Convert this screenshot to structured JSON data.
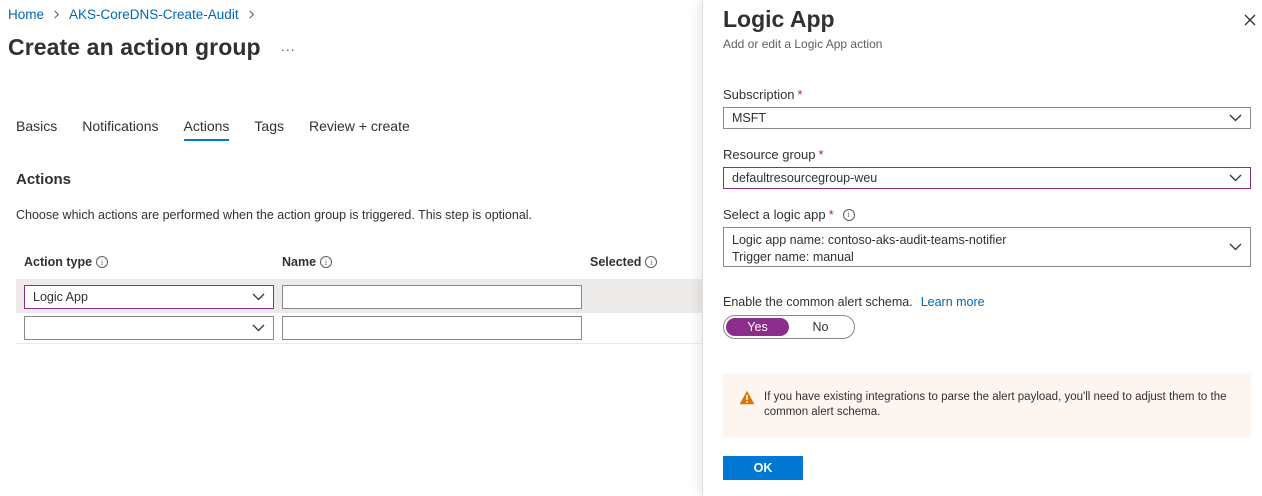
{
  "breadcrumb": {
    "items": [
      "Home",
      "AKS-CoreDNS-Create-Audit"
    ]
  },
  "page": {
    "title": "Create an action group",
    "more": "..."
  },
  "tabs": [
    {
      "label": "Basics",
      "active": false
    },
    {
      "label": "Notifications",
      "active": false
    },
    {
      "label": "Actions",
      "active": true
    },
    {
      "label": "Tags",
      "active": false
    },
    {
      "label": "Review + create",
      "active": false
    }
  ],
  "actions": {
    "title": "Actions",
    "description": "Choose which actions are performed when the action group is triggered. This step is optional.",
    "columns": [
      "Action type",
      "Name",
      "Selected"
    ],
    "rows": [
      {
        "action_type": "Logic App",
        "name": ""
      },
      {
        "action_type": "",
        "name": ""
      }
    ]
  },
  "panel": {
    "title": "Logic App",
    "subtitle": "Add or edit a Logic App action",
    "subscription_label": "Subscription",
    "subscription_value": "MSFT",
    "resource_group_label": "Resource group",
    "resource_group_value": "defaultresourcegroup-weu",
    "logic_app_label": "Select a logic app",
    "logic_app_line1": "Logic app name: contoso-aks-audit-teams-notifier",
    "logic_app_line2": "Trigger name: manual",
    "schema_label": "Enable the common alert schema.",
    "learn_more": "Learn more",
    "toggle_yes": "Yes",
    "toggle_no": "No",
    "toggle_value": "Yes",
    "warning_text": "If you have existing integrations to parse the alert payload, you'll need to adjust them to the common alert schema.",
    "ok_label": "OK",
    "required_mark": "*"
  },
  "colors": {
    "accent": "#0078d4",
    "toggle_on": "#8b2d8b",
    "link": "#0067b8",
    "required": "#a4262c",
    "warning_bg": "#fdf6f0",
    "warning_icon": "#d97706"
  },
  "icons": [
    "chevron-right-icon",
    "chevron-down-icon",
    "info-icon",
    "close-icon",
    "warning-icon",
    "more-icon"
  ]
}
